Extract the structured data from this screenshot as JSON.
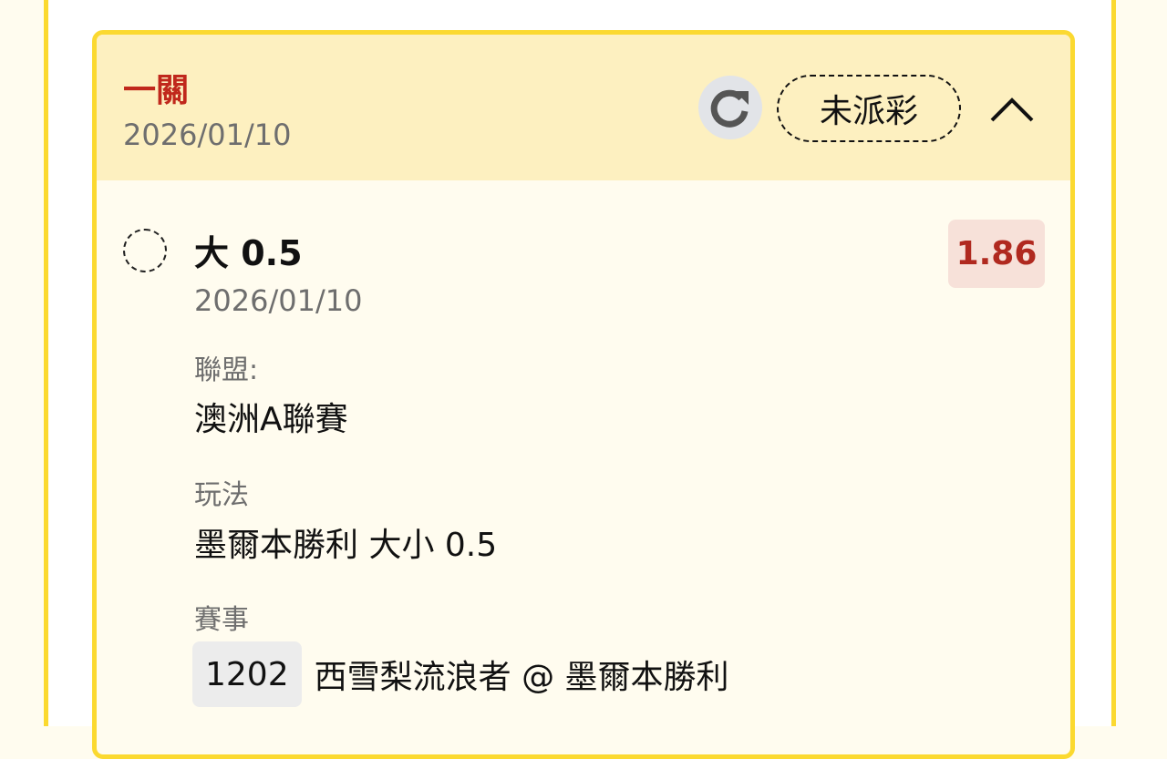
{
  "header": {
    "bet_type": "一關",
    "date": "2026/01/10",
    "status": "未派彩"
  },
  "selection": {
    "title": "大 0.5",
    "date": "2026/01/10",
    "odds": "1.86",
    "league_label": "聯盟:",
    "league_value": "澳洲A聯賽",
    "play_label": "玩法",
    "play_value": "墨爾本勝利 大小 0.5",
    "match_label": "賽事",
    "match_id": "1202",
    "match_name": "西雪梨流浪者 @ 墨爾本勝利"
  },
  "icons": {
    "refresh": "refresh-icon",
    "collapse": "chevron-up-icon"
  },
  "colors": {
    "accent_border": "#fbd930",
    "header_bg": "#fdf0c0",
    "bet_type_red": "#c0281c",
    "odds_bg": "#f7e1d9"
  }
}
